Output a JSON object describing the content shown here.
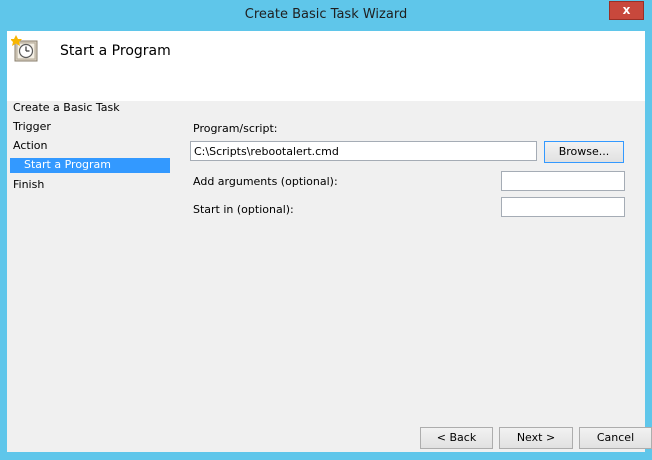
{
  "window": {
    "title": "Create Basic Task Wizard",
    "close_glyph": "x"
  },
  "header": {
    "title": "Start a Program",
    "icon": "task-scheduler-clock-icon"
  },
  "nav": {
    "items": [
      {
        "label": "Create a Basic Task",
        "selected": false
      },
      {
        "label": "Trigger",
        "selected": false
      },
      {
        "label": "Action",
        "selected": false
      },
      {
        "label": "Start a Program",
        "selected": true
      },
      {
        "label": "Finish",
        "selected": false
      }
    ]
  },
  "form": {
    "program_label": "Program/script:",
    "program_value": "C:\\Scripts\\rebootalert.cmd",
    "browse_label": "Browse...",
    "args_label": "Add arguments (optional):",
    "args_value": "",
    "startin_label": "Start in (optional):",
    "startin_value": ""
  },
  "footer": {
    "back_label": "< Back",
    "next_label": "Next >",
    "cancel_label": "Cancel"
  },
  "colors": {
    "frame": "#5fc6ea",
    "selection": "#3399ff",
    "close": "#c8483c"
  }
}
